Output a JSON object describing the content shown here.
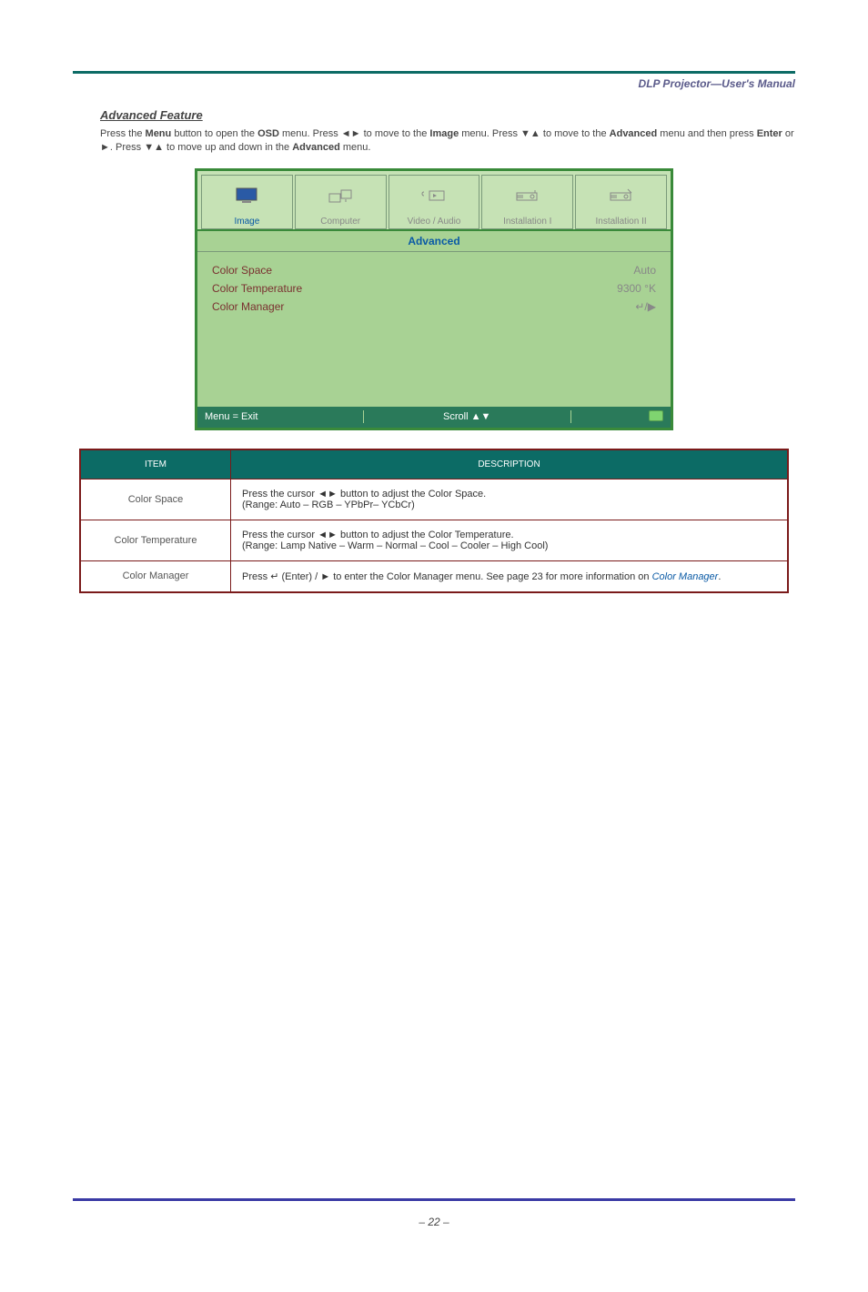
{
  "header": {
    "title": "DLP Projector—User's Manual"
  },
  "section": {
    "title": "Advanced Feature",
    "instructions_prefix": "Press the ",
    "menu_word": "Menu",
    "instructions_mid1": " button to open the ",
    "osd_word": "OSD",
    "instructions_mid2": " menu. Press ",
    "arrows_lr": "◄►",
    "instructions_mid3": " to move to the ",
    "image_word": "Image",
    "instructions_mid4": " menu. Press ",
    "arrows_ud": "▼▲",
    "instructions_mid5": " to move to the ",
    "advanced_word": "Advanced",
    "instructions_mid6": " menu and then press ",
    "enter_word": "Enter",
    "instructions_mid7": " or ",
    "arrow_r": "►",
    "instructions_mid8": ". Press ",
    "instructions_mid9": " to move up and down in the ",
    "instructions_end": " menu."
  },
  "osd": {
    "tabs": {
      "image": "Image",
      "computer": "Computer",
      "video_audio": "Video / Audio",
      "installation1": "Installation I",
      "installation2": "Installation II"
    },
    "subhead": "Advanced",
    "rows": {
      "color_space": {
        "label": "Color Space",
        "value": "Auto"
      },
      "color_temp": {
        "label": "Color Temperature",
        "value": "9300 °K"
      },
      "color_manager": {
        "label": "Color Manager",
        "value": "↵/▶"
      }
    },
    "footer": {
      "menu_exit": "Menu = Exit",
      "scroll": "Scroll ▲▼"
    }
  },
  "table": {
    "headers": {
      "item": "ITEM",
      "description": "DESCRIPTION"
    },
    "rows": {
      "r1": {
        "item": "Color Space",
        "desc_prefix": "Press the cursor ",
        "desc_suffix": " button to adjust the Color Space.\n(Range: Auto – RGB – YPbPr– YCbCr)"
      },
      "r2": {
        "item": "Color Temperature",
        "desc_prefix": "Press the cursor ",
        "desc_suffix": " button to adjust the Color Temperature.\n(Range: Lamp Native – Warm – Normal – Cool – Cooler – High Cool)"
      },
      "r3": {
        "item": "Color Manager",
        "desc_prefix": "Press ",
        "desc_mid": " (Enter) / ",
        "desc_suffix": " to enter the Color Manager menu. See page 23 for more information on ",
        "link": "Color Manager"
      }
    }
  },
  "page_number": "– 22 –"
}
